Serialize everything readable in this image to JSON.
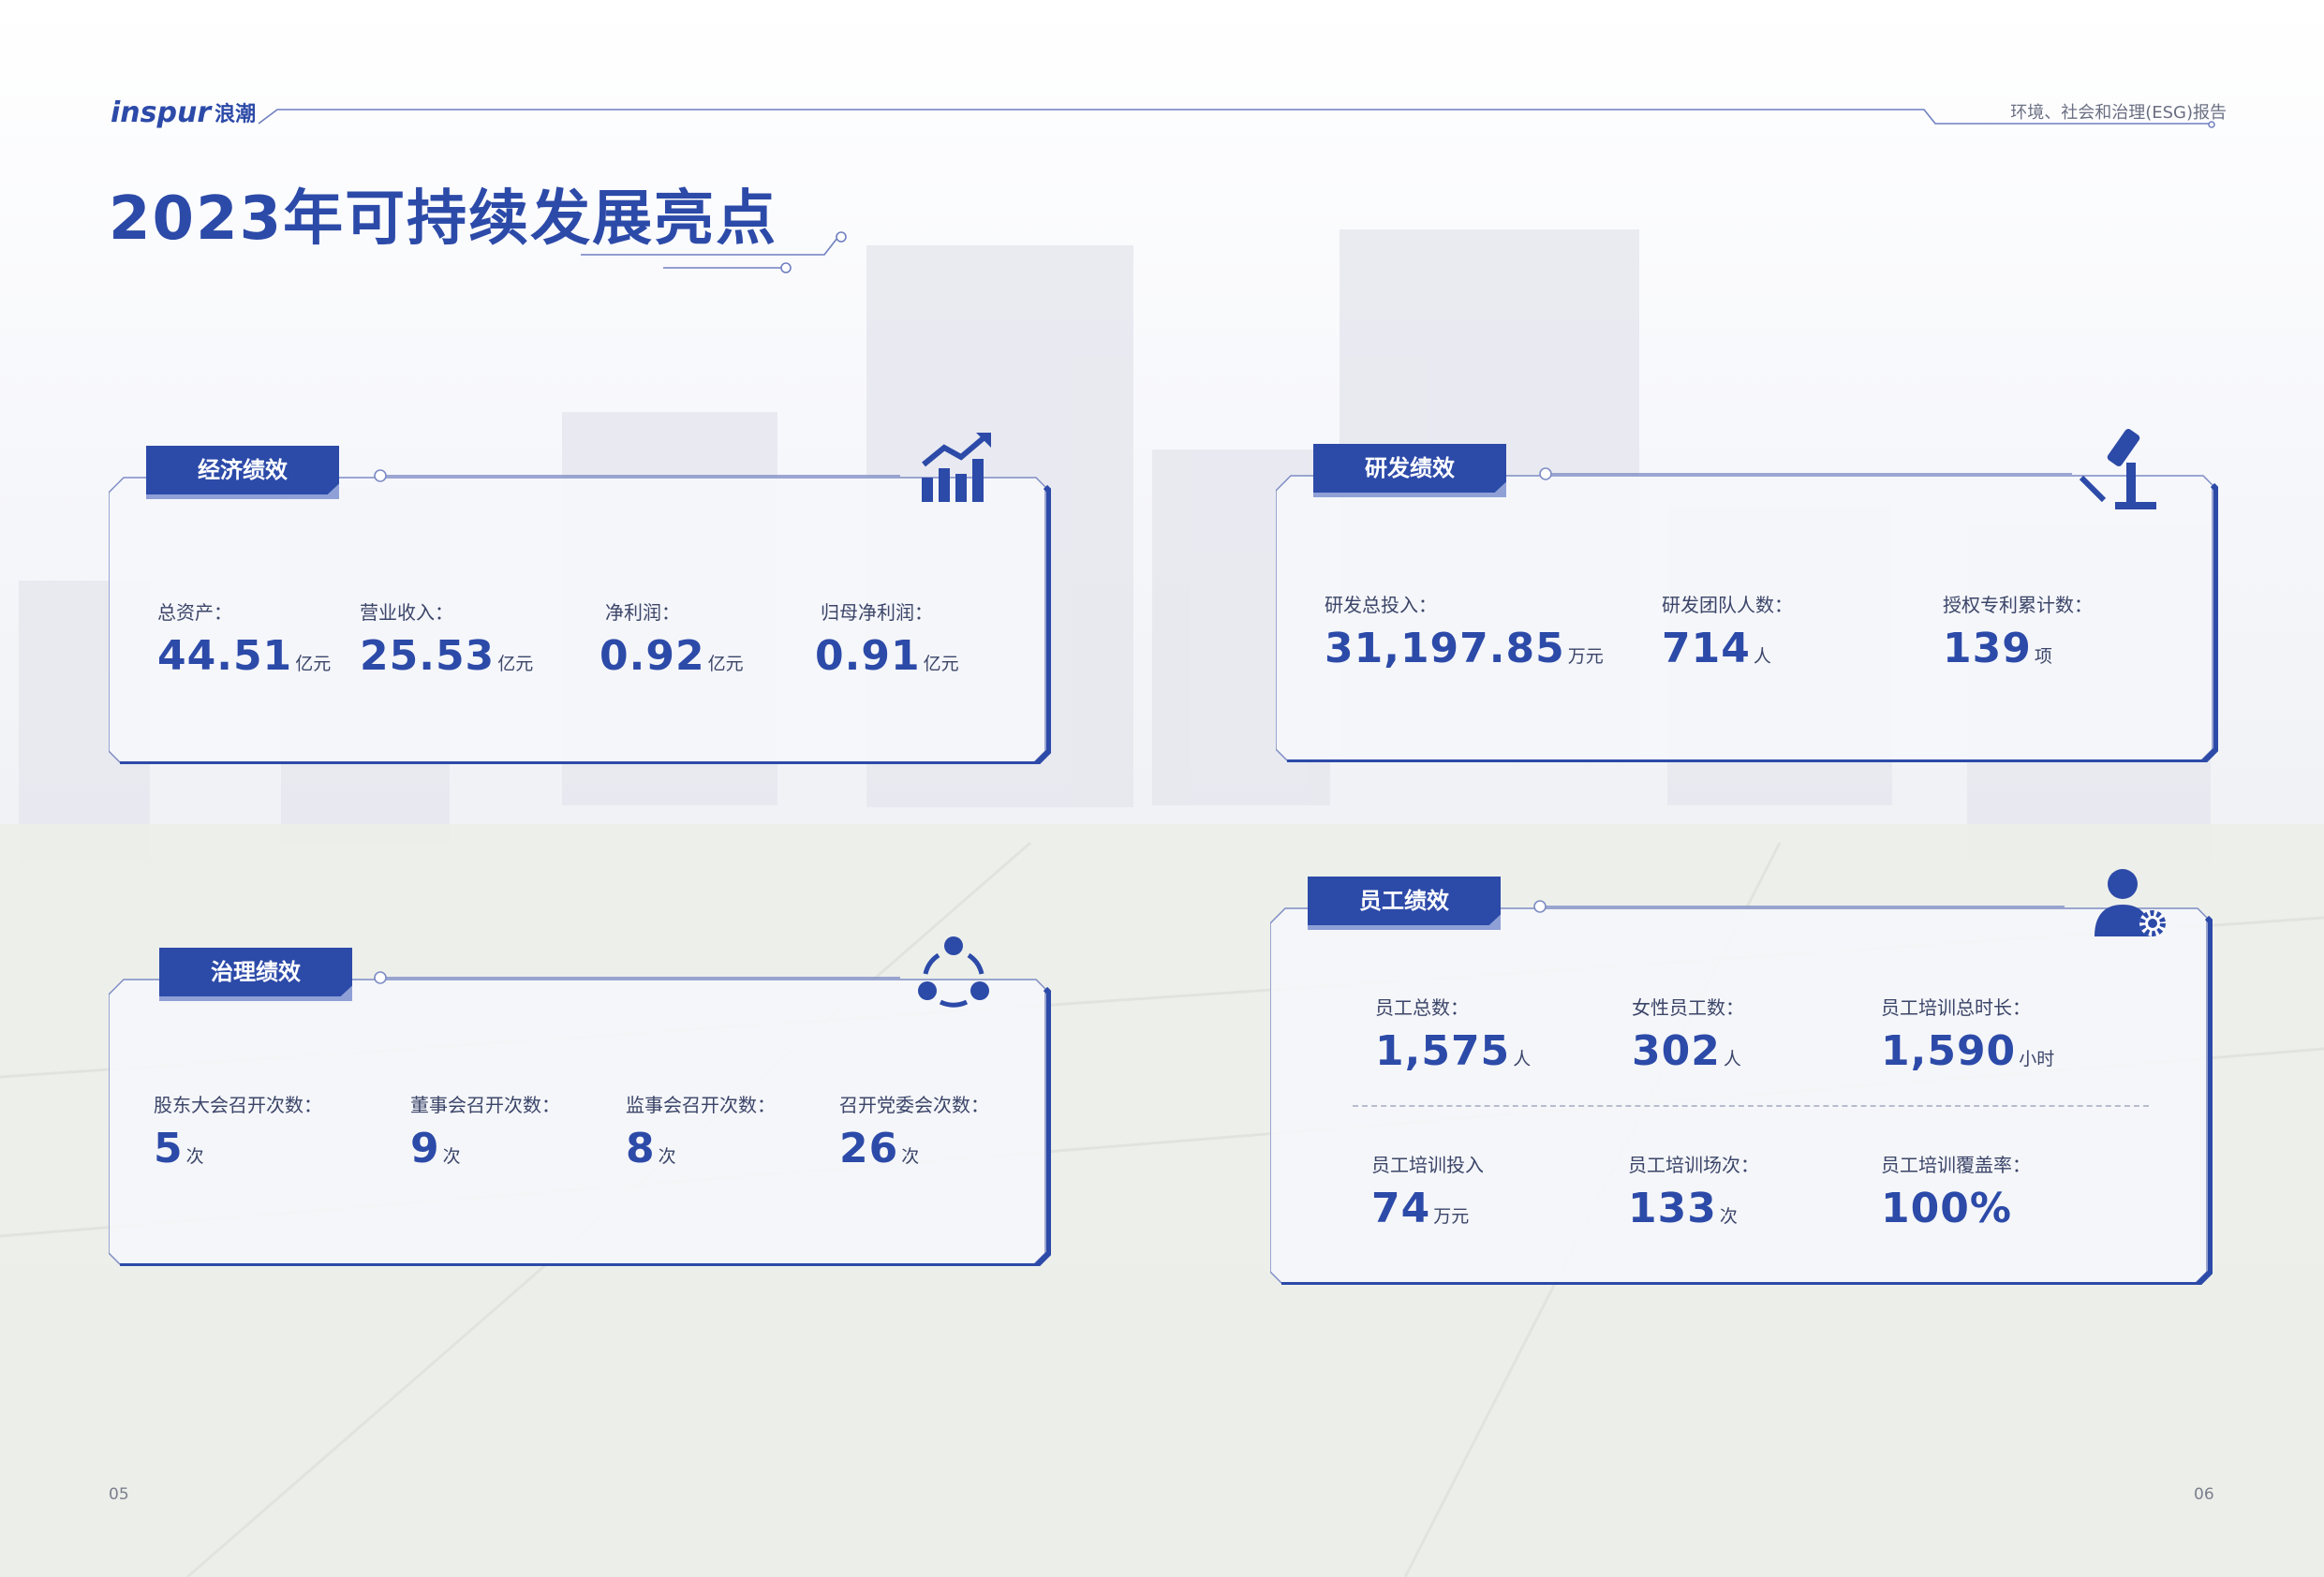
{
  "header": {
    "logo_latin": "inspur",
    "logo_cjk": "浪潮",
    "report_name": "环境、社会和治理(ESG)报告"
  },
  "page_title": "2023年可持续发展亮点",
  "page_numbers": {
    "left": "05",
    "right": "06"
  },
  "economic": {
    "title": "经济绩效",
    "icon": "growth-chart-icon",
    "stats": [
      {
        "label": "总资产：",
        "value": "44.51",
        "unit": "亿元"
      },
      {
        "label": "营业收入：",
        "value": "25.53",
        "unit": "亿元"
      },
      {
        "label": "净利润：",
        "value": "0.92",
        "unit": "亿元"
      },
      {
        "label": "归母净利润：",
        "value": "0.91",
        "unit": "亿元"
      }
    ]
  },
  "rnd": {
    "title": "研发绩效",
    "icon": "microscope-icon",
    "stats": [
      {
        "label": "研发总投入：",
        "value": "31,197.85",
        "unit": "万元"
      },
      {
        "label": "研发团队人数：",
        "value": "714",
        "unit": "人"
      },
      {
        "label": "授权专利累计数：",
        "value": "139",
        "unit": "项"
      }
    ]
  },
  "governance": {
    "title": "治理绩效",
    "icon": "network-cycle-icon",
    "stats": [
      {
        "label": "股东大会召开次数：",
        "value": "5",
        "unit": "次"
      },
      {
        "label": "董事会召开次数：",
        "value": "9",
        "unit": "次"
      },
      {
        "label": "监事会召开次数：",
        "value": "8",
        "unit": "次"
      },
      {
        "label": "召开党委会次数：",
        "value": "26",
        "unit": "次"
      }
    ]
  },
  "employee": {
    "title": "员工绩效",
    "icon": "person-gear-icon",
    "stats": [
      {
        "label": "员工总数：",
        "value": "1,575",
        "unit": "人"
      },
      {
        "label": "女性员工数：",
        "value": "302",
        "unit": "人"
      },
      {
        "label": "员工培训总时长：",
        "value": "1,590",
        "unit": "小时"
      },
      {
        "label": "员工培训投入",
        "value": "74",
        "unit": "万元"
      },
      {
        "label": "员工培训场次：",
        "value": "133",
        "unit": "次"
      },
      {
        "label": "员工培训覆盖率：",
        "value": "100%",
        "unit": ""
      }
    ]
  },
  "colors": {
    "brand": "#2c4aa8",
    "brand_light": "#8ea0d6",
    "text": "#3b4569"
  }
}
